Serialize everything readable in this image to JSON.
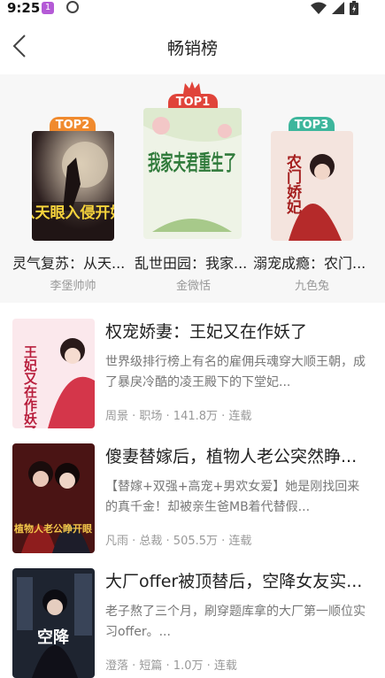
{
  "status_bar": {
    "time": "9:25",
    "noti_label": "1"
  },
  "header": {
    "title": "畅销榜"
  },
  "top_books": [
    {
      "badge": "TOP2",
      "title": "灵气复苏：从天...",
      "author": "李堡帅帅",
      "cover_text": "从天眼入侵开始",
      "cover_color": "#3a2a2a"
    },
    {
      "badge": "TOP1",
      "title": "乱世田园：我家...",
      "author": "金微恬",
      "cover_text": "我家夫君重生了",
      "cover_color": "#eef3e6"
    },
    {
      "badge": "TOP3",
      "title": "溺宠成瘾：农门...",
      "author": "九色兔",
      "cover_text": "农门娇妃",
      "cover_color": "#f4e4de"
    }
  ],
  "list": [
    {
      "title": "权宠娇妻：王妃又在作妖了",
      "desc": "世界级排行榜上有名的雇佣兵魂穿大顺王朝，成了暴戾冷酷的凌王殿下的下堂妃...",
      "meta": "周景 · 职场 · 141.8万 · 连载",
      "cover_text": "王妃又在作妖了"
    },
    {
      "title": "傻妻替嫁后，植物人老公突然睁...",
      "desc": "【替嫁+双强+高宠+男欢女爱】她是刚找回来的真千金！却被亲生爸MB着代替假...",
      "meta": "凡雨 · 总裁 · 505.5万 · 连载",
      "cover_text": "植物人老公睁开眼"
    },
    {
      "title": "大厂offer被顶替后，空降女友实...",
      "desc": "老子熬了三个月，刷穿题库拿的大厂第一顺位实习offer。...",
      "meta": "澄落 · 短篇 · 1.0万 · 连载",
      "cover_text": "空降"
    }
  ],
  "colors": {
    "top1": "#e0443a",
    "top2": "#f08a2e",
    "top3": "#3db69c"
  }
}
